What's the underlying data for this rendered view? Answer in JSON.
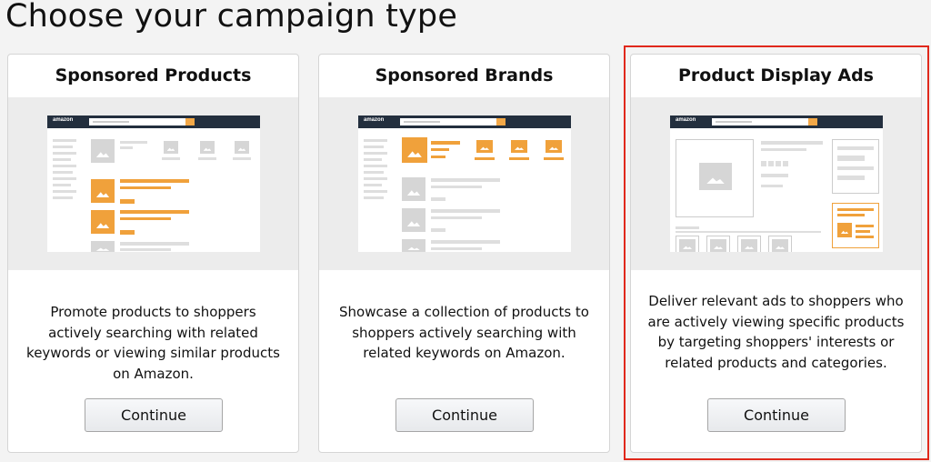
{
  "page": {
    "title": "Choose your campaign type"
  },
  "cards": [
    {
      "title": "Sponsored Products",
      "description": "Promote products to shoppers actively searching with related keywords or viewing similar products on Amazon.",
      "button_label": "Continue"
    },
    {
      "title": "Sponsored Brands",
      "description": "Showcase a collection of products to shoppers actively searching with related keywords on Amazon.",
      "button_label": "Continue"
    },
    {
      "title": "Product Display Ads",
      "description": "Deliver relevant ads to shoppers who are actively viewing specific products by targeting shoppers' interests or related products and categories.",
      "button_label": "Continue",
      "selected": true
    }
  ],
  "mockup": {
    "logo_text": "amazon"
  },
  "colors": {
    "highlight": "#e0281c",
    "accent": "#f0a13b",
    "header": "#232f3e"
  }
}
